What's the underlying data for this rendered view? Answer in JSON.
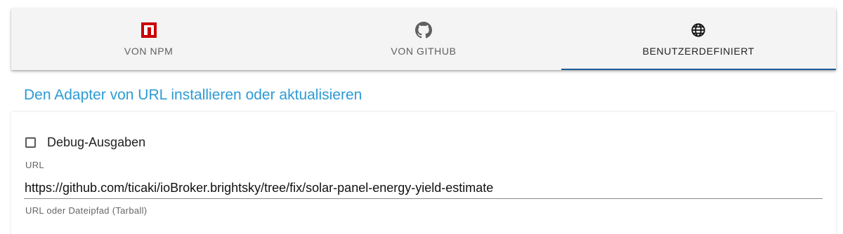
{
  "tabs": [
    {
      "label": "VON NPM",
      "icon": "npm-icon",
      "active": false
    },
    {
      "label": "VON GITHUB",
      "icon": "github-icon",
      "active": false
    },
    {
      "label": "BENUTZERDEFINIERT",
      "icon": "globe-icon",
      "active": true
    }
  ],
  "colors": {
    "npm_red": "#cb0000",
    "heading_blue": "#2d9bd4",
    "active_indicator": "#1c5b9a"
  },
  "section": {
    "heading": "Den Adapter von URL installieren oder aktualisieren"
  },
  "form": {
    "debug_label": "Debug-Ausgaben",
    "debug_checked": false,
    "url_label": "URL",
    "url_value": "https://github.com/ticaki/ioBroker.brightsky/tree/fix/solar-panel-energy-yield-estimate",
    "url_helper": "URL oder Dateipfad (Tarball)"
  }
}
